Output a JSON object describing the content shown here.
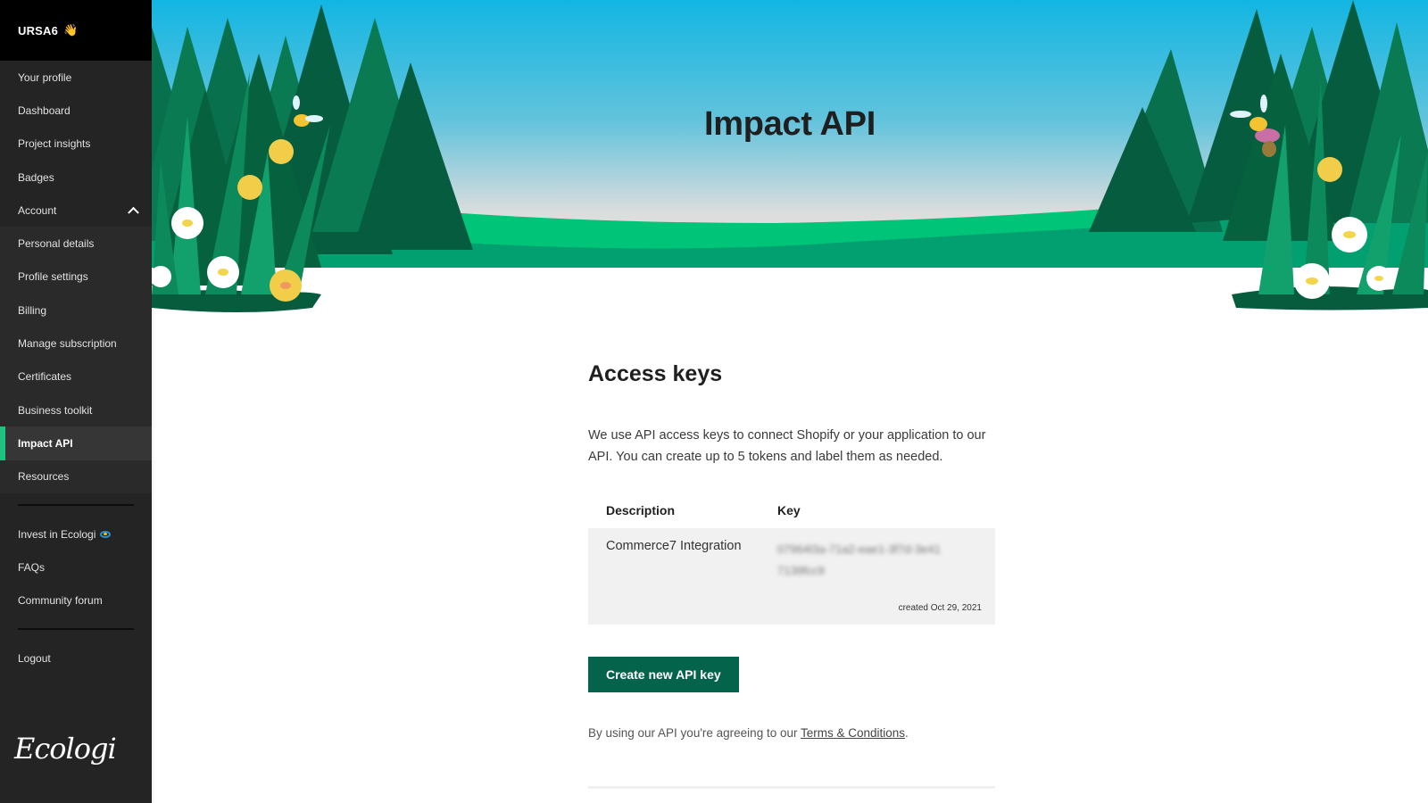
{
  "sidebar": {
    "username": "URSA6",
    "greeting_emoji": "👋",
    "items": [
      {
        "label": "Your profile"
      },
      {
        "label": "Dashboard"
      },
      {
        "label": "Project insights"
      },
      {
        "label": "Badges"
      },
      {
        "label": "Account",
        "expanded": true,
        "icon": "chevron-up-icon"
      }
    ],
    "account_items": [
      {
        "label": "Personal details"
      },
      {
        "label": "Profile settings"
      },
      {
        "label": "Billing"
      },
      {
        "label": "Manage subscription"
      },
      {
        "label": "Certificates"
      },
      {
        "label": "Business toolkit"
      },
      {
        "label": "Impact API",
        "active": true
      },
      {
        "label": "Resources"
      }
    ],
    "secondary_items": [
      {
        "label": "Invest in Ecologi",
        "icon": "globe-icon"
      },
      {
        "label": "FAQs"
      },
      {
        "label": "Community forum"
      }
    ],
    "logout_label": "Logout",
    "logo_text": "Ecologi",
    "active_color": "#1ec27e"
  },
  "hero": {
    "title": "Impact API"
  },
  "main": {
    "section_title": "Access keys",
    "intro": "We use API access keys to connect Shopify or your application to our API. You can create up to 5 tokens and label them as needed.",
    "table": {
      "headers": {
        "description": "Description",
        "key": "Key"
      },
      "rows": [
        {
          "description": "Commerce7 Integration",
          "key": "07964l3a-71a2-eae1-3f7d-3e417139fcc9",
          "created": "created Oct 29, 2021"
        }
      ]
    },
    "create_button_label": "Create new API key",
    "terms_prefix": "By using our API you're agreeing to our ",
    "terms_link": "Terms & Conditions",
    "terms_suffix": ".",
    "button_color": "#04634b"
  }
}
